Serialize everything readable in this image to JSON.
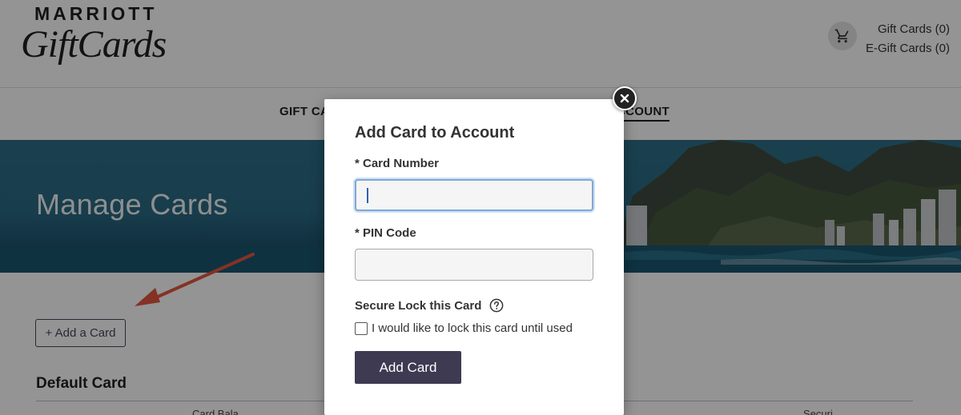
{
  "brand": {
    "line1": "MARRIOTT",
    "line2": "GiftCards"
  },
  "cart": {
    "gift_cards": "Gift Cards (0)",
    "egift_cards": "E-Gift Cards (0)",
    "icon": "shopping-cart-icon"
  },
  "nav": {
    "left_partial": "GIFT CA",
    "right_partial": "MY ACCOUNT"
  },
  "banner": {
    "title": "Manage Cards"
  },
  "page": {
    "add_card_label": "+ Add a Card",
    "section_title": "Default Card",
    "column_1": "Card Bala",
    "column_2": "Securi"
  },
  "modal": {
    "title": "Add Card to Account",
    "card_number_label": "* Card Number",
    "card_number_value": "",
    "pin_label": "* PIN Code",
    "pin_value": "",
    "secure_lock_label": "Secure Lock this Card",
    "lock_checkbox_label": "I would like to lock this card until used",
    "lock_checked": false,
    "submit_label": "Add Card",
    "close_icon": "close-icon",
    "help_icon": "question-circle-icon"
  },
  "colors": {
    "overlay": "#000000",
    "primary_button": "#3d3a52",
    "annotation_arrow": "#e4573f",
    "focus_ring": "#7fa8d6",
    "banner_sky": "#2d6f88"
  }
}
